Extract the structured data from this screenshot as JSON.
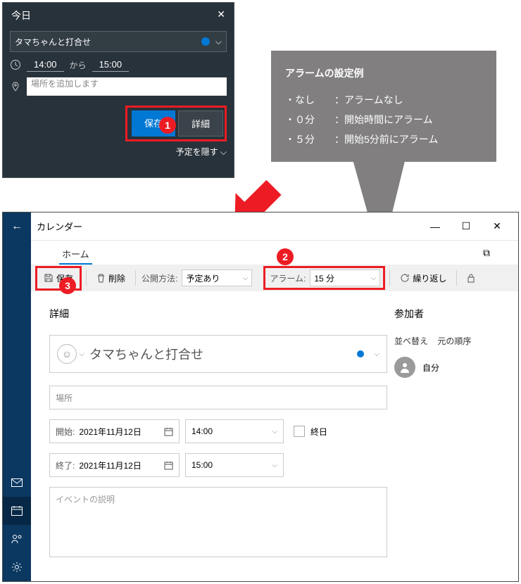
{
  "quick": {
    "header": "今日",
    "close": "✕",
    "title": "タマちゃんと打合せ",
    "start_time": "14:00",
    "kara": "から",
    "end_time": "15:00",
    "loc_placeholder": "場所を追加します",
    "save": "保存",
    "details": "詳細",
    "hide": "予定を隠す ⌵"
  },
  "hint": {
    "title": "アラームの設定例",
    "l1": "・なし　　：アラームなし",
    "l2": "・０分　　：開始時間にアラーム",
    "l3": "・５分　　：開始5分前にアラーム"
  },
  "badges": {
    "b1": "1",
    "b2": "2",
    "b3": "3"
  },
  "win": {
    "apptitle": "カレンダー",
    "back": "←",
    "min": "—",
    "max": "☐",
    "close": "✕",
    "tab_home": "ホーム",
    "save": "保存",
    "delete": "削除",
    "pub_label": "公開方法:",
    "pub_value": "予定あり",
    "alarm_label": "アラーム:",
    "alarm_value": "15 分",
    "repeat": "繰り返し",
    "share_icon": "⧉",
    "lock": "🔒"
  },
  "event": {
    "sec_detail": "詳細",
    "title": "タマちゃんと打合せ",
    "emoji": "☺",
    "loc_placeholder": "場所",
    "start_label": "開始:",
    "start_date": "2021年11月12日",
    "start_time": "14:00",
    "end_label": "終了:",
    "end_date": "2021年11月12日",
    "end_time": "15:00",
    "allday": "終日",
    "desc_placeholder": "イベントの説明",
    "sec_participants": "参加者",
    "sort": "並べ替え",
    "sort_orig": "元の順序",
    "self": "自分"
  }
}
